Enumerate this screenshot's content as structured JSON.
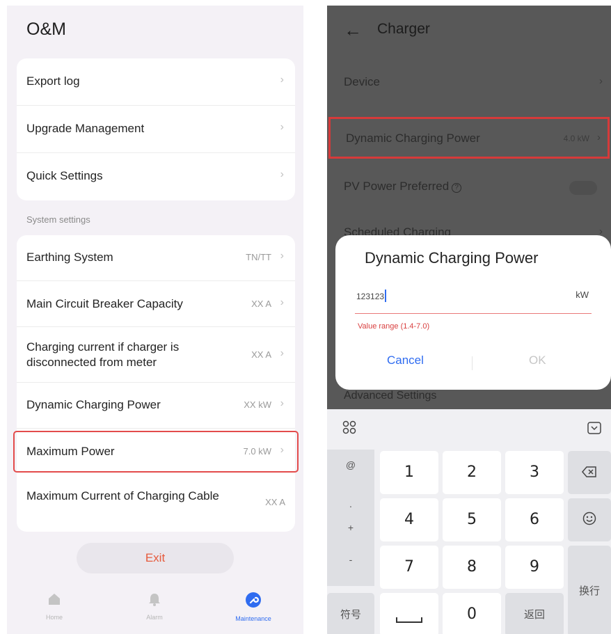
{
  "left": {
    "title": "O&M",
    "top_menu": [
      {
        "label": "Export log"
      },
      {
        "label": "Upgrade Management"
      },
      {
        "label": "Quick Settings"
      }
    ],
    "section_label": "System settings",
    "settings": [
      {
        "label": "Earthing System",
        "value": "TN/TT"
      },
      {
        "label": "Main Circuit Breaker Capacity",
        "value": "XX A"
      },
      {
        "label": "Charging current if charger is disconnected from meter",
        "value": "XX A"
      },
      {
        "label": "Dynamic Charging Power",
        "value": "XX kW"
      },
      {
        "label": "Maximum Power",
        "value": "7.0 kW"
      },
      {
        "label": "Maximum Current of Charging Cable",
        "value": "XX A"
      }
    ],
    "exit_label": "Exit",
    "nav": [
      {
        "label": "Home",
        "icon": "home-icon"
      },
      {
        "label": "Alarm",
        "icon": "bell-icon"
      },
      {
        "label": "Maintenance",
        "icon": "wrench-icon",
        "active": true
      }
    ]
  },
  "right": {
    "title": "Charger",
    "rows": [
      {
        "label": "Device"
      },
      {
        "label": "Dynamic Charging Power",
        "value": "4.0 kW"
      },
      {
        "label": "PV Power Preferred"
      },
      {
        "label": "Scheduled Charging"
      }
    ],
    "dialog": {
      "title": "Dynamic Charging Power",
      "input_value": "123123",
      "unit": "kW",
      "range_hint": "Value range (1.4-7.0)",
      "cancel_label": "Cancel",
      "ok_label": "OK"
    },
    "peek_label": "Advanced Settings",
    "keyboard": {
      "digits": [
        "1",
        "2",
        "3",
        "4",
        "5",
        "6",
        "7",
        "8",
        "9",
        "0"
      ],
      "sym_keys": [
        "@",
        ".",
        "+",
        "-"
      ],
      "symbols_label": "符号",
      "space_label": "",
      "return_label": "返回",
      "newline_label": "换行"
    }
  },
  "colors": {
    "accent": "#2f6cf0",
    "highlight_border": "#e34b4b",
    "error_text": "#d94040",
    "exit_text": "#e65a3c"
  }
}
